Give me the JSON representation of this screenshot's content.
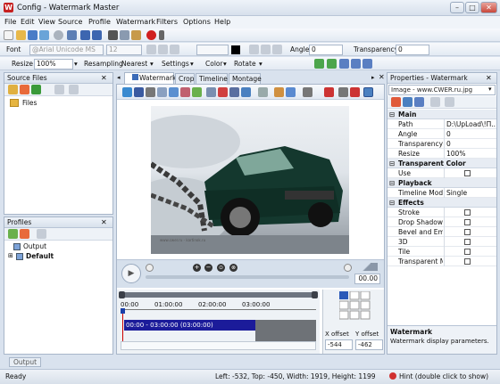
{
  "app": {
    "title": "Config - Watermark Master",
    "icon_letter": "W"
  },
  "window": {
    "minimize": "–",
    "maximize": "□",
    "close": "✕"
  },
  "menu": [
    "File",
    "Edit",
    "View",
    "Source",
    "Profile",
    "Watermark",
    "Filters",
    "Options",
    "Help"
  ],
  "toolbar2": {
    "font_label": "Font",
    "font_value": "@Arial Unicode MS",
    "size_value": "12",
    "angle_label": "Angle",
    "angle_value": "0",
    "transparency_label": "Transparency",
    "transparency_value": "0"
  },
  "toolbar3": {
    "resize_label": "Resize",
    "resize_value": "100%",
    "resampling_label": "Resampling",
    "resampling_value": "Nearest",
    "settings_label": "Settings",
    "color_label": "Color",
    "rotate_label": "Rotate"
  },
  "source_files": {
    "title": "Source Files",
    "items": [
      "Files"
    ]
  },
  "profiles": {
    "title": "Profiles",
    "items": [
      "Output",
      "Default"
    ]
  },
  "tabs": [
    "Watermark",
    "Crop",
    "Timeline",
    "Montage"
  ],
  "player": {
    "time_value": "00.00"
  },
  "timeline": {
    "ticks": [
      "00:00",
      "01:00:00",
      "02:00:00",
      "03:00:00"
    ],
    "clip_label": "00:00 - 03:00:00 (03:00:00)",
    "x_offset_label": "X offset",
    "y_offset_label": "Y offset",
    "x_offset_value": "-544",
    "y_offset_value": "-462"
  },
  "properties": {
    "title": "Properties - Watermark",
    "selector": "Image - www.CWER.ru.jpg",
    "sections": [
      {
        "name": "Main",
        "rows": [
          {
            "k": "Path",
            "v": "D:\\UpLoad\\!Π..."
          },
          {
            "k": "Angle",
            "v": "0"
          },
          {
            "k": "Transparency",
            "v": "0"
          },
          {
            "k": "Resize",
            "v": "100%"
          }
        ]
      },
      {
        "name": "Transparent Color",
        "rows": [
          {
            "k": "Use",
            "v": "",
            "check": true
          }
        ]
      },
      {
        "name": "Playback",
        "rows": [
          {
            "k": "Timeline Mode",
            "v": "Single"
          }
        ]
      },
      {
        "name": "Effects",
        "rows": [
          {
            "k": "Stroke",
            "v": "",
            "check": true
          },
          {
            "k": "Drop Shadow",
            "v": "",
            "check": true
          },
          {
            "k": "Bevel and Emb",
            "v": "",
            "check": true
          },
          {
            "k": "3D",
            "v": "",
            "check": true
          },
          {
            "k": "Tile",
            "v": "",
            "check": true
          },
          {
            "k": "Transparent M",
            "v": "",
            "check": true
          }
        ]
      }
    ],
    "help_title": "Watermark",
    "help_text": "Watermark display parameters."
  },
  "bottom_tab": "Output",
  "status": {
    "left": "Ready",
    "coords": "Left: -532, Top: -450, Width: 1919, Height: 1199",
    "hint": "Hint (double click to show)"
  },
  "image": {
    "watermark_text": "www.cwer.ru - kartinok.ru"
  }
}
